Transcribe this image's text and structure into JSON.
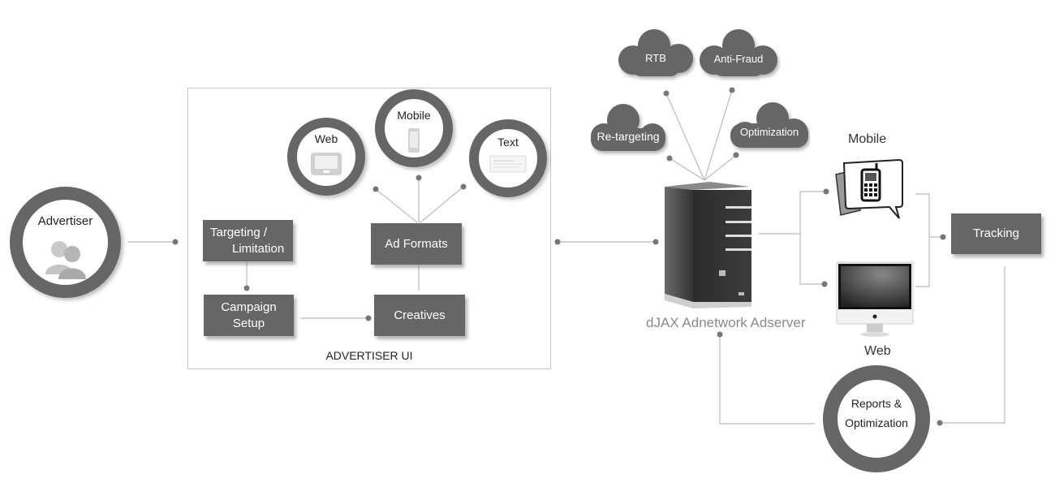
{
  "advertiser": {
    "label": "Advertiser",
    "icon": "users-icon"
  },
  "advertiser_ui": {
    "title": "ADVERTISER UI",
    "formats": [
      {
        "label": "Web",
        "icon": "tablet-icon"
      },
      {
        "label": "Mobile",
        "icon": "smartphone-icon"
      },
      {
        "label": "Text",
        "icon": "text-ad-icon"
      }
    ],
    "boxes": {
      "targeting_line1": "Targeting /",
      "targeting_line2": "Limitation",
      "ad_formats": "Ad Formats",
      "campaign_line1": "Campaign",
      "campaign_line2": "Setup",
      "creatives": "Creatives"
    }
  },
  "clouds": {
    "rtb": "RTB",
    "anti_fraud": "Anti-Fraud",
    "retargeting": "Re-targeting",
    "optimization": "Optimization"
  },
  "adserver": {
    "label": "dJAX Adnetwork Adserver",
    "icon": "server-tower-icon"
  },
  "channels": {
    "mobile": {
      "label": "Mobile",
      "icon": "mobile-phone-chat-icon"
    },
    "web": {
      "label": "Web",
      "icon": "desktop-monitor-icon"
    }
  },
  "tracking": {
    "label": "Tracking"
  },
  "reports": {
    "line1": "Reports &",
    "line2": "Optimization"
  },
  "colors": {
    "box": "#666666",
    "ring": "#666666",
    "line": "#bbbbbb",
    "adserver_text": "#8a8a8a"
  }
}
